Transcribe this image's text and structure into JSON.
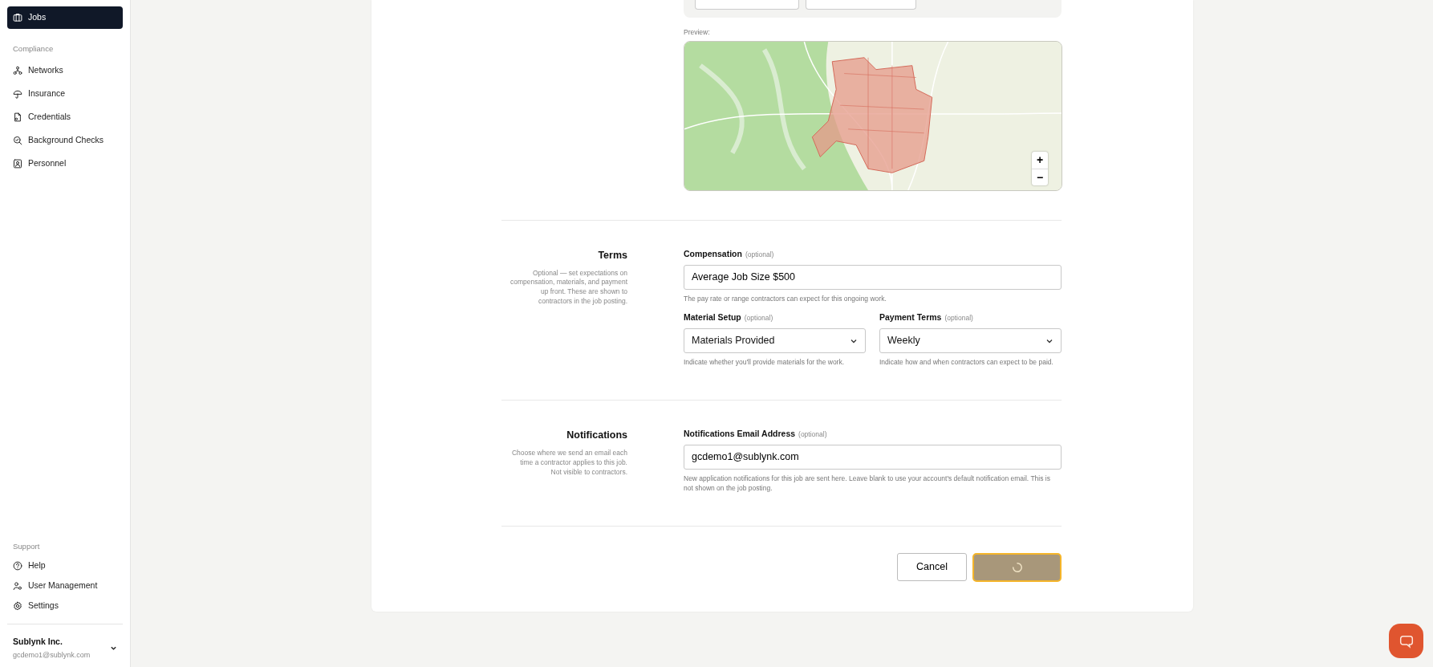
{
  "sidebar": {
    "items": [
      {
        "label": "Jobs",
        "kind": "briefcase",
        "selected": true
      }
    ],
    "sections": [
      {
        "heading": "Compliance",
        "items": [
          {
            "label": "Networks",
            "kind": "network",
            "selected": false
          },
          {
            "label": "Insurance",
            "kind": "umbrella",
            "selected": false
          },
          {
            "label": "Credentials",
            "kind": "document",
            "selected": false
          },
          {
            "label": "Background Checks",
            "kind": "search",
            "selected": false
          },
          {
            "label": "Personnel",
            "kind": "person-card",
            "selected": false
          }
        ]
      }
    ],
    "support": {
      "heading": "Support",
      "items": [
        {
          "label": "Help",
          "kind": "help",
          "selected": false
        },
        {
          "label": "User Management",
          "kind": "users",
          "selected": false
        },
        {
          "label": "Settings",
          "kind": "settings",
          "selected": false
        }
      ]
    },
    "account": {
      "name": "Sublynk Inc.",
      "email": "gcdemo1@sublynk.com"
    }
  },
  "service_area": {
    "preview_label": "Preview:",
    "map_controls": [
      "+",
      "−"
    ]
  },
  "sections": [
    {
      "title": "Terms",
      "description": "Optional — set expectations on compensation, materials, and payment up front. These are shown to contractors in the job posting.",
      "rows": [
        [
          {
            "kind": "text",
            "label": "Compensation",
            "note": "(optional)",
            "value": "Average Job Size $500",
            "help": "The pay rate or range contractors can expect for this ongoing work."
          }
        ],
        [
          {
            "kind": "select",
            "label": "Material Setup",
            "note": "(optional)",
            "value": "Materials Provided",
            "help": "Indicate whether you'll provide materials for the work."
          },
          {
            "kind": "select",
            "label": "Payment Terms",
            "note": "(optional)",
            "value": "Weekly",
            "help": "Indicate how and when contractors can expect to be paid."
          }
        ]
      ]
    },
    {
      "title": "Notifications",
      "description": "Choose where we send an email each time a contractor applies to this job. Not visible to contractors.",
      "rows": [
        [
          {
            "kind": "text",
            "label": "Notifications Email Address",
            "note": "(optional)",
            "value": "gcdemo1@sublynk.com",
            "help": "New application notifications for this job are sent here. Leave blank to use your account's default notification email. This is not shown on the job posting."
          }
        ]
      ]
    }
  ],
  "actions": {
    "cancel": "Cancel",
    "submit_loading": true
  }
}
